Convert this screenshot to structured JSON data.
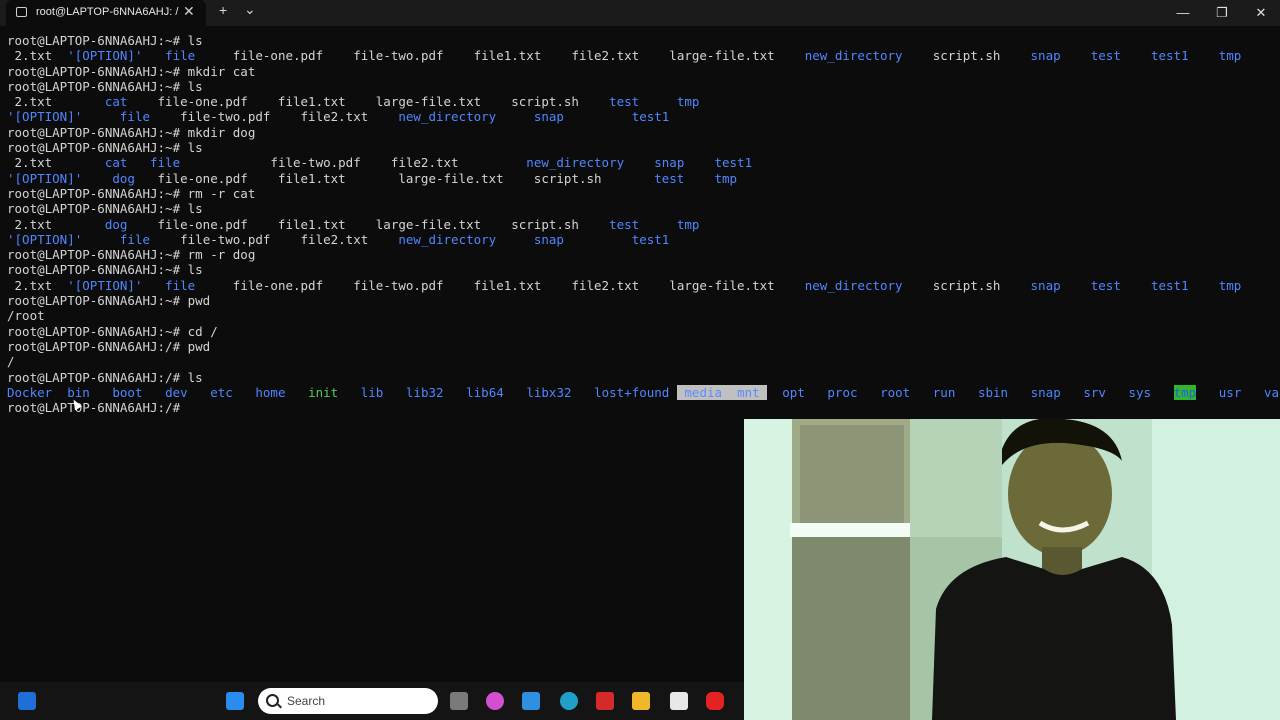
{
  "window": {
    "tab_title": "root@LAPTOP-6NNA6AHJ: /",
    "tab_close": "✕",
    "new_tab": "+",
    "dropdown": "⌄",
    "minimize": "—",
    "maximize": "❐",
    "close": "✕"
  },
  "terminal": {
    "lines": [
      [
        {
          "t": "root@LAPTOP-6NNA6AHJ:~# ls"
        }
      ],
      [
        {
          "t": " 2.txt  "
        },
        {
          "t": "'[OPTION]'",
          "c": "opt"
        },
        {
          "t": "   "
        },
        {
          "t": "file",
          "c": "dir"
        },
        {
          "t": "     file-one.pdf    file-two.pdf    file1.txt    file2.txt    large-file.txt    "
        },
        {
          "t": "new_directory",
          "c": "dir"
        },
        {
          "t": "    script.sh    "
        },
        {
          "t": "snap",
          "c": "dir"
        },
        {
          "t": "    "
        },
        {
          "t": "test",
          "c": "dir"
        },
        {
          "t": "    "
        },
        {
          "t": "test1",
          "c": "dir"
        },
        {
          "t": "    "
        },
        {
          "t": "tmp",
          "c": "dir"
        }
      ],
      [
        {
          "t": "root@LAPTOP-6NNA6AHJ:~# mkdir cat"
        }
      ],
      [
        {
          "t": "root@LAPTOP-6NNA6AHJ:~# ls"
        }
      ],
      [
        {
          "t": " 2.txt       "
        },
        {
          "t": "cat",
          "c": "dir"
        },
        {
          "t": "    file-one.pdf    file1.txt    large-file.txt    script.sh    "
        },
        {
          "t": "test",
          "c": "dir"
        },
        {
          "t": "     "
        },
        {
          "t": "tmp",
          "c": "dir"
        }
      ],
      [
        {
          "t": "'[OPTION]'",
          "c": "opt"
        },
        {
          "t": "     "
        },
        {
          "t": "file",
          "c": "dir"
        },
        {
          "t": "    file-two.pdf    file2.txt    "
        },
        {
          "t": "new_directory",
          "c": "dir"
        },
        {
          "t": "     "
        },
        {
          "t": "snap",
          "c": "dir"
        },
        {
          "t": "         "
        },
        {
          "t": "test1",
          "c": "dir"
        }
      ],
      [
        {
          "t": "root@LAPTOP-6NNA6AHJ:~# mkdir dog"
        }
      ],
      [
        {
          "t": "root@LAPTOP-6NNA6AHJ:~# ls"
        }
      ],
      [
        {
          "t": " 2.txt       "
        },
        {
          "t": "cat",
          "c": "dir"
        },
        {
          "t": "   "
        },
        {
          "t": "file",
          "c": "dir"
        },
        {
          "t": "            file-two.pdf    file2.txt         "
        },
        {
          "t": "new_directory",
          "c": "dir"
        },
        {
          "t": "    "
        },
        {
          "t": "snap",
          "c": "dir"
        },
        {
          "t": "    "
        },
        {
          "t": "test1",
          "c": "dir"
        }
      ],
      [
        {
          "t": "'[OPTION]'",
          "c": "opt"
        },
        {
          "t": "    "
        },
        {
          "t": "dog",
          "c": "dir"
        },
        {
          "t": "   file-one.pdf    file1.txt       large-file.txt    script.sh       "
        },
        {
          "t": "test",
          "c": "dir"
        },
        {
          "t": "    "
        },
        {
          "t": "tmp",
          "c": "dir"
        }
      ],
      [
        {
          "t": "root@LAPTOP-6NNA6AHJ:~# rm -r cat"
        }
      ],
      [
        {
          "t": "root@LAPTOP-6NNA6AHJ:~# ls"
        }
      ],
      [
        {
          "t": " 2.txt       "
        },
        {
          "t": "dog",
          "c": "dir"
        },
        {
          "t": "    file-one.pdf    file1.txt    large-file.txt    script.sh    "
        },
        {
          "t": "test",
          "c": "dir"
        },
        {
          "t": "     "
        },
        {
          "t": "tmp",
          "c": "dir"
        }
      ],
      [
        {
          "t": "'[OPTION]'",
          "c": "opt"
        },
        {
          "t": "     "
        },
        {
          "t": "file",
          "c": "dir"
        },
        {
          "t": "    file-two.pdf    file2.txt    "
        },
        {
          "t": "new_directory",
          "c": "dir"
        },
        {
          "t": "     "
        },
        {
          "t": "snap",
          "c": "dir"
        },
        {
          "t": "         "
        },
        {
          "t": "test1",
          "c": "dir"
        }
      ],
      [
        {
          "t": "root@LAPTOP-6NNA6AHJ:~# rm -r dog"
        }
      ],
      [
        {
          "t": "root@LAPTOP-6NNA6AHJ:~# ls"
        }
      ],
      [
        {
          "t": " 2.txt  "
        },
        {
          "t": "'[OPTION]'",
          "c": "opt"
        },
        {
          "t": "   "
        },
        {
          "t": "file",
          "c": "dir"
        },
        {
          "t": "     file-one.pdf    file-two.pdf    file1.txt    file2.txt    large-file.txt    "
        },
        {
          "t": "new_directory",
          "c": "dir"
        },
        {
          "t": "    script.sh    "
        },
        {
          "t": "snap",
          "c": "dir"
        },
        {
          "t": "    "
        },
        {
          "t": "test",
          "c": "dir"
        },
        {
          "t": "    "
        },
        {
          "t": "test1",
          "c": "dir"
        },
        {
          "t": "    "
        },
        {
          "t": "tmp",
          "c": "dir"
        }
      ],
      [
        {
          "t": "root@LAPTOP-6NNA6AHJ:~# pwd"
        }
      ],
      [
        {
          "t": "/root"
        }
      ],
      [
        {
          "t": "root@LAPTOP-6NNA6AHJ:~# cd /"
        }
      ],
      [
        {
          "t": "root@LAPTOP-6NNA6AHJ:/# pwd"
        }
      ],
      [
        {
          "t": "/"
        }
      ],
      [
        {
          "t": "root@LAPTOP-6NNA6AHJ:/# ls"
        }
      ],
      [
        {
          "t": "Docker",
          "c": "dir"
        },
        {
          "t": "  "
        },
        {
          "t": "bin",
          "c": "dir"
        },
        {
          "t": "   "
        },
        {
          "t": "boot",
          "c": "dir"
        },
        {
          "t": "   "
        },
        {
          "t": "dev",
          "c": "dir"
        },
        {
          "t": "   "
        },
        {
          "t": "etc",
          "c": "dir"
        },
        {
          "t": "   "
        },
        {
          "t": "home",
          "c": "dir"
        },
        {
          "t": "   "
        },
        {
          "t": "init",
          "c": "exe"
        },
        {
          "t": "   "
        },
        {
          "t": "lib",
          "c": "dir"
        },
        {
          "t": "   "
        },
        {
          "t": "lib32",
          "c": "dir"
        },
        {
          "t": "   "
        },
        {
          "t": "lib64",
          "c": "dir"
        },
        {
          "t": "   "
        },
        {
          "t": "libx32",
          "c": "dir"
        },
        {
          "t": "   "
        },
        {
          "t": "lost+found",
          "c": "dir"
        },
        {
          "t": " "
        },
        {
          "t": " media  mnt ",
          "c": "sticky"
        },
        {
          "t": "  "
        },
        {
          "t": "opt",
          "c": "dir"
        },
        {
          "t": "   "
        },
        {
          "t": "proc",
          "c": "dir"
        },
        {
          "t": "   "
        },
        {
          "t": "root",
          "c": "dir"
        },
        {
          "t": "   "
        },
        {
          "t": "run",
          "c": "dir"
        },
        {
          "t": "   "
        },
        {
          "t": "sbin",
          "c": "dir"
        },
        {
          "t": "   "
        },
        {
          "t": "snap",
          "c": "dir"
        },
        {
          "t": "   "
        },
        {
          "t": "srv",
          "c": "dir"
        },
        {
          "t": "   "
        },
        {
          "t": "sys",
          "c": "dir"
        },
        {
          "t": "   "
        },
        {
          "t": "tmp",
          "c": "tmpbg"
        },
        {
          "t": "   "
        },
        {
          "t": "usr",
          "c": "dir"
        },
        {
          "t": "   "
        },
        {
          "t": "var",
          "c": "dir"
        }
      ],
      [
        {
          "t": "root@LAPTOP-6NNA6AHJ:/#"
        }
      ]
    ]
  },
  "taskbar": {
    "search_placeholder": "Search",
    "icons": [
      "windows-start-icon",
      "windows-logo-icon",
      "task-view-icon",
      "copilot-icon",
      "vscode-icon",
      "edge-icon",
      "mcafee-icon",
      "file-explorer-icon",
      "microsoft-store-icon",
      "youtube-icon"
    ]
  }
}
